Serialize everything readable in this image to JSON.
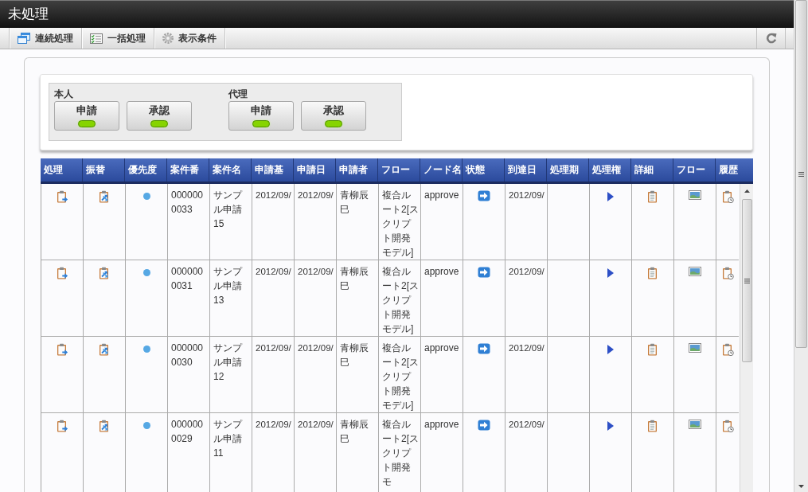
{
  "window": {
    "title": "未処理"
  },
  "toolbar": {
    "buttons": [
      {
        "label": "連続処理",
        "kind": "windows"
      },
      {
        "label": "一括処理",
        "kind": "checklist"
      },
      {
        "label": "表示条件",
        "kind": "gear"
      }
    ]
  },
  "filter": {
    "groups": [
      {
        "label": "本人",
        "buttons": [
          {
            "label": "申請",
            "lit": true
          },
          {
            "label": "承認",
            "lit": true
          }
        ]
      },
      {
        "label": "代理",
        "buttons": [
          {
            "label": "申請",
            "lit": true
          },
          {
            "label": "承認",
            "lit": true
          }
        ]
      }
    ]
  },
  "table": {
    "columns": [
      {
        "label": "処理",
        "kind": "process"
      },
      {
        "label": "振替",
        "kind": "transfer"
      },
      {
        "label": "優先度",
        "kind": "priority"
      },
      {
        "label": "案件番",
        "kind": "text"
      },
      {
        "label": "案件名",
        "kind": "text"
      },
      {
        "label": "申請基",
        "kind": "date"
      },
      {
        "label": "申請日",
        "kind": "date"
      },
      {
        "label": "申請者",
        "kind": "text"
      },
      {
        "label": "フロー",
        "kind": "text"
      },
      {
        "label": "ノード名",
        "kind": "text"
      },
      {
        "label": "状態",
        "kind": "status"
      },
      {
        "label": "到達日",
        "kind": "date"
      },
      {
        "label": "処理期",
        "kind": "text"
      },
      {
        "label": "処理権",
        "kind": "authority"
      },
      {
        "label": "詳細",
        "kind": "detail"
      },
      {
        "label": "フロー",
        "kind": "flow"
      },
      {
        "label": "履歴",
        "kind": "history"
      }
    ],
    "rows": [
      {
        "color": "#56a8e4",
        "cells": [
          "",
          "",
          "",
          "0000000033",
          "サンプル申請15",
          "2012/09/",
          "2012/09/",
          "青柳辰巳",
          "複合ルート2[スクリプト開発モデル]",
          "approve",
          "",
          "2012/09/",
          "",
          "",
          "",
          "",
          ""
        ]
      },
      {
        "color": "#56a8e4",
        "cells": [
          "",
          "",
          "",
          "0000000031",
          "サンプル申請13",
          "2012/09/",
          "2012/09/",
          "青柳辰巳",
          "複合ルート2[スクリプト開発モデル]",
          "approve",
          "",
          "2012/09/",
          "",
          "",
          "",
          "",
          ""
        ]
      },
      {
        "color": "#56a8e4",
        "cells": [
          "",
          "",
          "",
          "0000000030",
          "サンプル申請12",
          "2012/09/",
          "2012/09/",
          "青柳辰巳",
          "複合ルート2[スクリプト開発モデル]",
          "approve",
          "",
          "2012/09/",
          "",
          "",
          "",
          "",
          ""
        ]
      },
      {
        "color": "#56a8e4",
        "cells": [
          "",
          "",
          "",
          "0000000029",
          "サンプル申請11",
          "2012/09/",
          "2012/09/",
          "青柳辰巳",
          "複合ルート2[スクリプト開発モ",
          "approve",
          "",
          "2012/09/",
          "",
          "",
          "",
          "",
          ""
        ]
      }
    ]
  }
}
